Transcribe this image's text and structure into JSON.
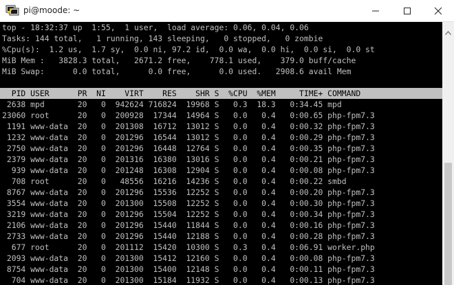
{
  "window": {
    "title": "pi@moode: ~"
  },
  "summary": [
    "top - 18:32:37 up  1:55,  1 user,  load average: 0.06, 0.04, 0.06",
    "Tasks: 144 total,   1 running, 143 sleeping,   0 stopped,   0 zombie",
    "%Cpu(s):  1.2 us,  1.7 sy,  0.0 ni, 97.2 id,  0.0 wa,  0.0 hi,  0.0 si,  0.0 st",
    "MiB Mem :   3828.3 total,   2671.2 free,    778.1 used,    379.0 buff/cache",
    "MiB Swap:      0.0 total,      0.0 free,      0.0 used.   2908.6 avail Mem"
  ],
  "table": {
    "columns": [
      "PID",
      "USER",
      "PR",
      "NI",
      "VIRT",
      "RES",
      "SHR",
      "S",
      "%CPU",
      "%MEM",
      "TIME+",
      "COMMAND"
    ],
    "rows": [
      [
        "2638",
        "mpd",
        "20",
        "0",
        "942624",
        "716824",
        "19968",
        "S",
        "0.3",
        "18.3",
        "0:34.45",
        "mpd"
      ],
      [
        "23060",
        "root",
        "20",
        "0",
        "200928",
        "17344",
        "14964",
        "S",
        "0.0",
        "0.4",
        "0:00.65",
        "php-fpm7.3"
      ],
      [
        "1191",
        "www-data",
        "20",
        "0",
        "201308",
        "16712",
        "13012",
        "S",
        "0.0",
        "0.4",
        "0:00.32",
        "php-fpm7.3"
      ],
      [
        "1232",
        "www-data",
        "20",
        "0",
        "201296",
        "16544",
        "13012",
        "S",
        "0.0",
        "0.4",
        "0:00.29",
        "php-fpm7.3"
      ],
      [
        "2750",
        "www-data",
        "20",
        "0",
        "201296",
        "16448",
        "12764",
        "S",
        "0.0",
        "0.4",
        "0:00.35",
        "php-fpm7.3"
      ],
      [
        "2379",
        "www-data",
        "20",
        "0",
        "201316",
        "16380",
        "13016",
        "S",
        "0.0",
        "0.4",
        "0:00.21",
        "php-fpm7.3"
      ],
      [
        "939",
        "www-data",
        "20",
        "0",
        "201248",
        "16308",
        "12904",
        "S",
        "0.0",
        "0.4",
        "0:00.08",
        "php-fpm7.3"
      ],
      [
        "708",
        "root",
        "20",
        "0",
        "48556",
        "16216",
        "14236",
        "S",
        "0.0",
        "0.4",
        "0:00.22",
        "smbd"
      ],
      [
        "8767",
        "www-data",
        "20",
        "0",
        "201296",
        "15536",
        "12252",
        "S",
        "0.0",
        "0.4",
        "0:00.20",
        "php-fpm7.3"
      ],
      [
        "3554",
        "www-data",
        "20",
        "0",
        "201300",
        "15508",
        "12252",
        "S",
        "0.0",
        "0.4",
        "0:00.30",
        "php-fpm7.3"
      ],
      [
        "3219",
        "www-data",
        "20",
        "0",
        "201296",
        "15504",
        "12252",
        "S",
        "0.0",
        "0.4",
        "0:00.34",
        "php-fpm7.3"
      ],
      [
        "2106",
        "www-data",
        "20",
        "0",
        "201296",
        "15440",
        "11844",
        "S",
        "0.0",
        "0.4",
        "0:00.16",
        "php-fpm7.3"
      ],
      [
        "2733",
        "www-data",
        "20",
        "0",
        "201296",
        "15440",
        "12188",
        "S",
        "0.0",
        "0.4",
        "0:00.28",
        "php-fpm7.3"
      ],
      [
        "677",
        "root",
        "20",
        "0",
        "201112",
        "15420",
        "10300",
        "S",
        "0.3",
        "0.4",
        "0:06.91",
        "worker.php"
      ],
      [
        "2093",
        "www-data",
        "20",
        "0",
        "201300",
        "15412",
        "12160",
        "S",
        "0.0",
        "0.4",
        "0:00.08",
        "php-fpm7.3"
      ],
      [
        "8754",
        "www-data",
        "20",
        "0",
        "201300",
        "15400",
        "12148",
        "S",
        "0.0",
        "0.4",
        "0:00.11",
        "php-fpm7.3"
      ],
      [
        "704",
        "www-data",
        "20",
        "0",
        "201300",
        "15184",
        "11932",
        "S",
        "0.0",
        "0.4",
        "0:00.13",
        "php-fpm7.3"
      ]
    ]
  },
  "icons": {
    "app": "putty-terminal-icon",
    "minimize": "minimize-icon",
    "maximize": "maximize-icon",
    "close": "close-icon"
  },
  "colors": {
    "terminal_background": "#000000",
    "terminal_text": "#c0c0c0",
    "header_bar": "#c0c0c0"
  }
}
